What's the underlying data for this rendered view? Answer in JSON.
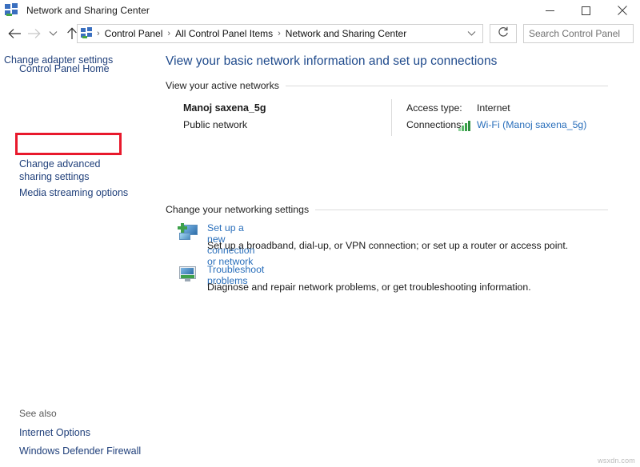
{
  "window": {
    "title": "Network and Sharing Center",
    "icon": "network-sharing-icon",
    "controls": {
      "minimize": "minimize-icon",
      "maximize": "maximize-icon",
      "close": "close-icon"
    }
  },
  "navbar": {
    "back": "back-arrow-icon",
    "forward": "forward-arrow-icon",
    "recent": "chevron-down-icon",
    "up": "up-arrow-icon",
    "breadcrumb": [
      "Control Panel",
      "All Control Panel Items",
      "Network and Sharing Center"
    ],
    "separator": "›",
    "dropdown": "chevron-down-icon",
    "refresh": "refresh-icon",
    "search": {
      "placeholder": "Search Control Panel",
      "value": "",
      "icon": "search-icon"
    }
  },
  "sidebar": {
    "items": [
      {
        "label": "Control Panel Home",
        "highlighted": false
      },
      {
        "label": "Change adapter settings",
        "highlighted": true
      },
      {
        "label": "Change advanced sharing settings",
        "highlighted": false
      },
      {
        "label": "Media streaming options",
        "highlighted": false
      }
    ],
    "see_also": {
      "title": "See also",
      "items": [
        {
          "label": "Internet Options"
        },
        {
          "label": "Windows Defender Firewall"
        }
      ]
    }
  },
  "content": {
    "page_title": "View your basic network information and set up connections",
    "sections": {
      "active_networks": {
        "heading": "View your active networks",
        "network_name": "Manoj saxena_5g",
        "network_type": "Public network",
        "access_type_label": "Access type:",
        "access_type_value": "Internet",
        "connections_label": "Connections:",
        "connections_link": "Wi-Fi (Manoj saxena_5g)",
        "connections_icon": "wifi-signal-icon"
      },
      "networking_settings": {
        "heading": "Change your networking settings",
        "tasks": [
          {
            "icon": "new-connection-icon",
            "link": "Set up a new connection or network",
            "description": "Set up a broadband, dial-up, or VPN connection; or set up a router or access point."
          },
          {
            "icon": "troubleshoot-icon",
            "link": "Troubleshoot problems",
            "description": "Diagnose and repair network problems, or get troubleshooting information."
          }
        ]
      }
    }
  },
  "watermark": "wsxdn.com",
  "colors": {
    "link": "#2a6fbb",
    "sidebar_link": "#1f3f7a",
    "page_title": "#1f4a8c",
    "highlight_border": "#e8192c",
    "signal_green": "#3aa14a"
  }
}
